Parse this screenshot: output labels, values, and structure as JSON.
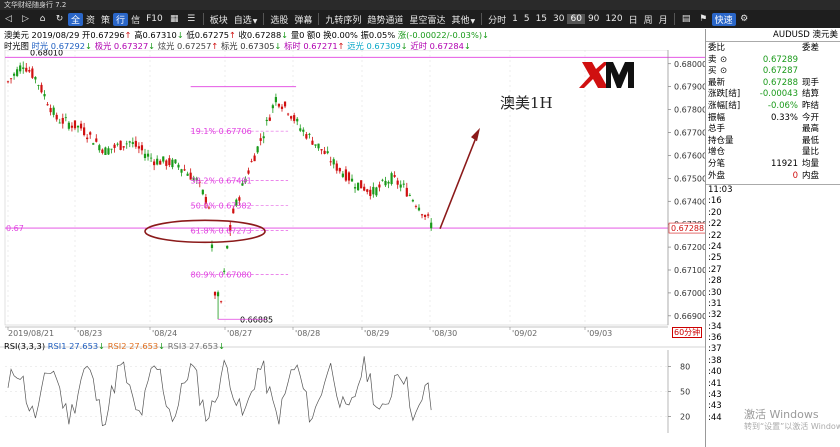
{
  "window": {
    "title": "文华财经随身行 7.2"
  },
  "toolbar": {
    "items": [
      "板块",
      "自选",
      "选股",
      "弹幕",
      "九转序列",
      "趋势通道",
      "星空雷达",
      "其他",
      "分时",
      "1",
      "5",
      "15",
      "30",
      "60",
      "90",
      "120",
      "日",
      "周",
      "月"
    ],
    "badge_a": "全",
    "tab_news": "资",
    "tab_strategy": "策",
    "tab_quote": "行",
    "tab_letter": "信",
    "tab_f10": "F10",
    "tab_data": "信",
    "active_period": "60",
    "quick": "快速"
  },
  "quote_header": {
    "symbol_cn": "澳美元",
    "date": "2019/08/29",
    "open": "开0.67296",
    "open_arrow": "↑",
    "high": "高0.67310",
    "high_arrow": "↓",
    "low": "低0.67275",
    "low_arrow": "↑",
    "close": "收0.67288",
    "close_arrow": "↓",
    "volume": "量0",
    "oi": "额0",
    "turnover": "换0.00%",
    "swing": "振0.05%",
    "change": "涨(-0.00022/-0.03%)",
    "change_arrow": "↓"
  },
  "ma_line": {
    "label": "时光图",
    "t1": "时光 0.67292",
    "t1_arrow": "↓",
    "t2": "极光 0.67327",
    "t2_arrow": "↓",
    "t3": "炫光 0.67257",
    "t3_arrow": "↑",
    "t4": "标光 0.67305",
    "t4_arrow": "↓",
    "t5": "标时 0.67271",
    "t5_arrow": "↑",
    "t6": "远光 0.67309",
    "t6_arrow": "↓",
    "t7": "近时 0.67284",
    "t7_arrow": "↓"
  },
  "chart": {
    "high_label": "0.68010",
    "low_label": "0.66885",
    "ref_label": "0.67",
    "price_tag": "0.67288",
    "timeframe": "60分钟",
    "annotation": "澳美1H",
    "logo": "XM",
    "fib_levels": [
      {
        "label": "19.1% 0.67706"
      },
      {
        "label": "38.2% 0.67491"
      },
      {
        "label": "50.0% 0.67382"
      },
      {
        "label": "61.8% 0.67273"
      },
      {
        "label": "80.9% 0.67080"
      }
    ],
    "y_ticks": [
      "0.68000",
      "0.67900",
      "0.67800",
      "0.67700",
      "0.67600",
      "0.67500",
      "0.67400",
      "0.67300",
      "0.67200",
      "0.67100",
      "0.67000",
      "0.66900"
    ],
    "x_ticks": [
      "2019/08/21",
      "'08/23",
      "'08/24",
      "'08/27",
      "'08/28",
      "'08/29",
      "'08/30",
      "'09/02",
      "'09/03"
    ]
  },
  "rsi": {
    "label": "RSI(3,3,3)",
    "rsi1": "RSI1 27.653",
    "rsi1_arrow": "↓",
    "rsi2": "RSI2 27.653",
    "rsi2_arrow": "↓",
    "rsi3": "RSI3 27.653",
    "rsi3_arrow": "↓",
    "ticks": [
      "80",
      "50",
      "20"
    ]
  },
  "panel": {
    "symbol": "AUDUSD 澳元美",
    "rows": [
      {
        "l": "委比",
        "v": "",
        "l2": "委差"
      },
      {
        "l": "卖",
        "v": "0.67289",
        "l2": ""
      },
      {
        "l": "买",
        "v": "0.67287",
        "l2": ""
      },
      {
        "l": "最新",
        "v": "0.67288",
        "l2": "现手"
      },
      {
        "l": "涨跌[结]",
        "v": "-0.00043",
        "l2": "结算"
      },
      {
        "l": "涨幅[结]",
        "v": "-0.06%",
        "l2": "昨结"
      },
      {
        "l": "振幅",
        "v": "0.33%",
        "l2": "今开"
      },
      {
        "l": "总手",
        "v": "",
        "l2": "最高"
      },
      {
        "l": "持仓量",
        "v": "",
        "l2": "最低"
      },
      {
        "l": "增仓",
        "v": "",
        "l2": "量比"
      },
      {
        "l": "分笔",
        "v": "11921",
        "l2": "均量"
      },
      {
        "l": "外盘",
        "v": "0",
        "l2": "内盘"
      }
    ],
    "times": [
      "11:03",
      ":16",
      ":20",
      ":22",
      ":22",
      ":24",
      ":25",
      ":27",
      ":28",
      ":30",
      ":31",
      ":32",
      ":34",
      ":36",
      ":37",
      ":38",
      ":40",
      ":41",
      ":43",
      ":43",
      ":44"
    ]
  },
  "watermark": {
    "line1": "激活 Windows",
    "line2": "转到“设置”以激活 Windows。"
  },
  "colors": {
    "up": "#d01010",
    "down": "#1a9a1a",
    "fib": "#e040e0",
    "arrow": "#8b1a1a",
    "ellipse": "#8b1a1a"
  }
}
